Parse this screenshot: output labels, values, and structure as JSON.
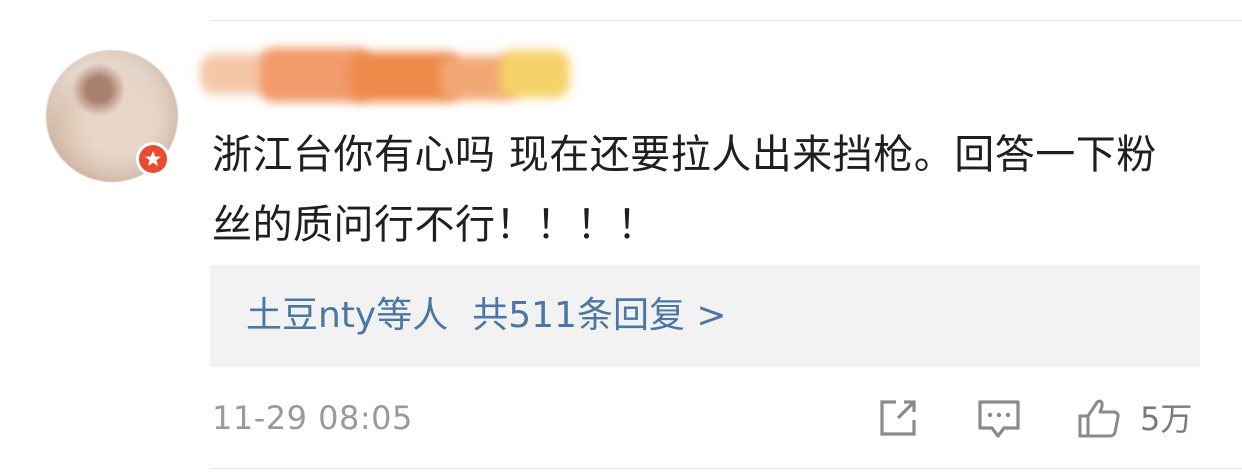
{
  "comment": {
    "text": "浙江台你有心吗 现在还要拉人出来挡枪。回答一下粉丝的质问行不行！！！！",
    "author_name_visible": false
  },
  "replies": {
    "users": "土豆nty等人",
    "summary": "共511条回复",
    "arrow": ">"
  },
  "footer": {
    "timestamp": "11-29 08:05",
    "like_count": "5万"
  },
  "icons": {
    "share": "share-icon",
    "comment": "comment-icon",
    "like": "thumbs-up-icon",
    "verified": "verified-badge-icon"
  },
  "colors": {
    "link": "#4b77a5",
    "reply_box_bg": "#f2f2f2",
    "timestamp": "#9a9a9a",
    "badge": "#ea4b30"
  }
}
